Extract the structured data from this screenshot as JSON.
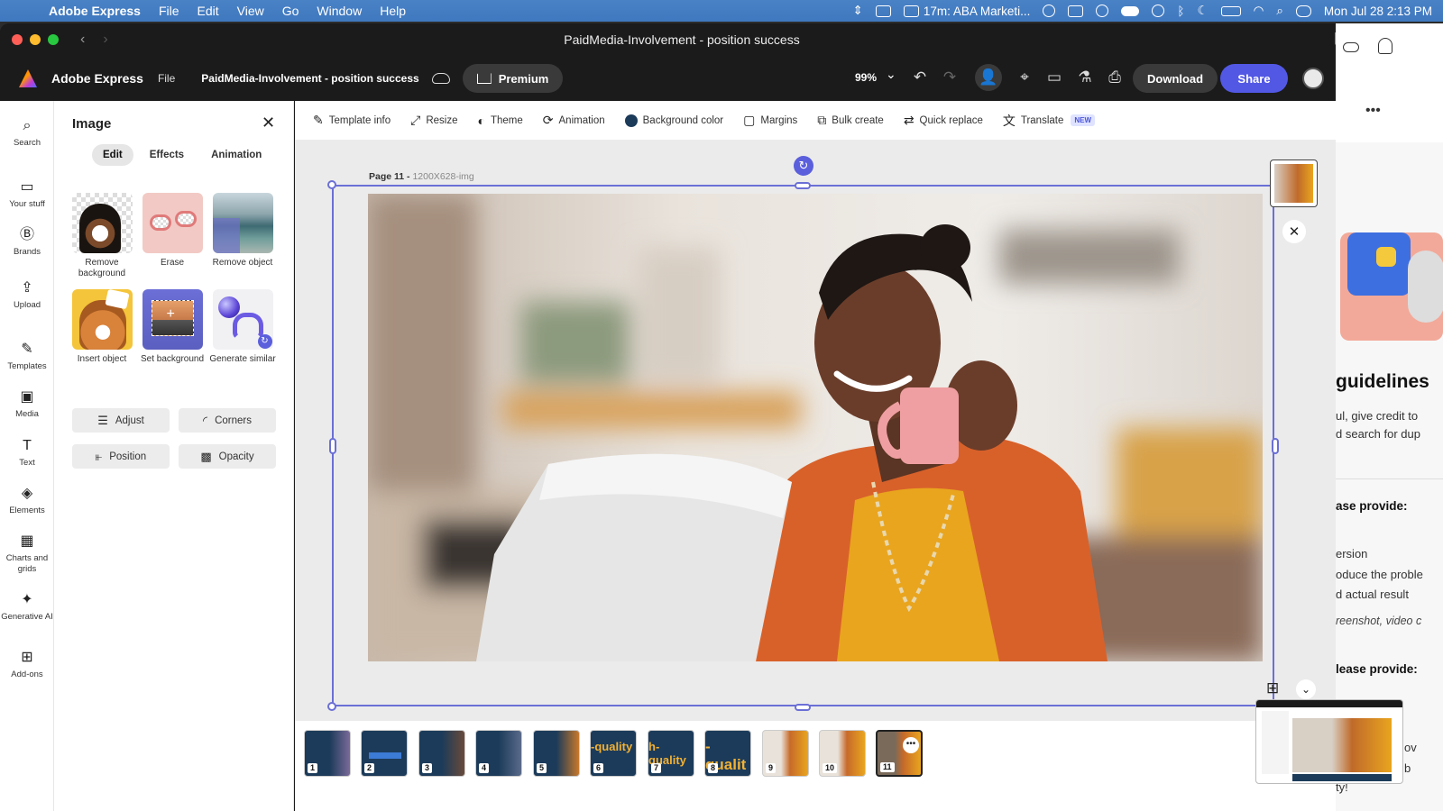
{
  "menubar": {
    "app": "Adobe Express",
    "items": [
      "File",
      "Edit",
      "View",
      "Go",
      "Window",
      "Help"
    ],
    "meeting": "17m:  ABA Marketi...",
    "datetime": "Mon Jul 28  2:13 PM"
  },
  "window": {
    "title": "PaidMedia-Involvement - position success"
  },
  "appbar": {
    "app_name": "Adobe Express",
    "file_label": "File",
    "doc_name": "PaidMedia-Involvement - position success",
    "premium_label": "Premium",
    "zoom": "99%",
    "download_label": "Download",
    "share_label": "Share"
  },
  "rail": [
    {
      "label": "Search",
      "icon": "search-icon"
    },
    {
      "label": "Your stuff",
      "icon": "folder-icon"
    },
    {
      "label": "Brands",
      "icon": "brand-icon"
    },
    {
      "label": "Upload",
      "icon": "upload-icon"
    },
    {
      "label": "Templates",
      "icon": "templates-icon"
    },
    {
      "label": "Media",
      "icon": "media-icon"
    },
    {
      "label": "Text",
      "icon": "text-icon"
    },
    {
      "label": "Elements",
      "icon": "elements-icon"
    },
    {
      "label": "Charts and grids",
      "icon": "charts-icon"
    },
    {
      "label": "Generative AI",
      "icon": "generative-ai-icon"
    },
    {
      "label": "Add-ons",
      "icon": "add-ons-icon"
    }
  ],
  "panel": {
    "title": "Image",
    "tabs": [
      "Edit",
      "Effects",
      "Animation"
    ],
    "active_tab": "Edit",
    "tools": [
      "Remove background",
      "Erase",
      "Remove object",
      "Insert object",
      "Set background",
      "Generate similar"
    ],
    "buttons": [
      "Adjust",
      "Corners",
      "Position",
      "Opacity"
    ]
  },
  "toolbar": [
    {
      "label": "Template info",
      "icon": "template-info-icon"
    },
    {
      "label": "Resize",
      "icon": "resize-icon"
    },
    {
      "label": "Theme",
      "icon": "theme-icon"
    },
    {
      "label": "Animation",
      "icon": "animation-icon"
    },
    {
      "label": "Background color",
      "icon": "background-color-swatch",
      "color": "#1c3b5a"
    },
    {
      "label": "Margins",
      "icon": "margins-icon"
    },
    {
      "label": "Bulk create",
      "icon": "bulk-create-icon"
    },
    {
      "label": "Quick replace",
      "icon": "quick-replace-icon"
    },
    {
      "label": "Translate",
      "icon": "translate-icon",
      "badge": "NEW"
    }
  ],
  "canvas": {
    "page_label": "Page 11 -",
    "page_size": "1200X628-img"
  },
  "pages": [
    {
      "num": "1"
    },
    {
      "num": "2"
    },
    {
      "num": "3"
    },
    {
      "num": "4"
    },
    {
      "num": "5"
    },
    {
      "num": "6"
    },
    {
      "num": "7"
    },
    {
      "num": "8"
    },
    {
      "num": "9"
    },
    {
      "num": "10"
    },
    {
      "num": "11"
    }
  ],
  "right_panel": {
    "heading": "guidelines",
    "line1": "ul, give credit to",
    "line2": "d search for dup",
    "label1": "ase provide:",
    "item1": "ersion",
    "item2": "oduce the proble",
    "item3": "d actual result",
    "item4": "reenshot, video c",
    "label2": "lease provide:",
    "tail1": "ov",
    "tail2": "b",
    "tail3": "ty!"
  },
  "colors": {
    "accent": "#5258e4",
    "selection": "#6b6fd6",
    "page_bg": "#1c3b5a"
  }
}
